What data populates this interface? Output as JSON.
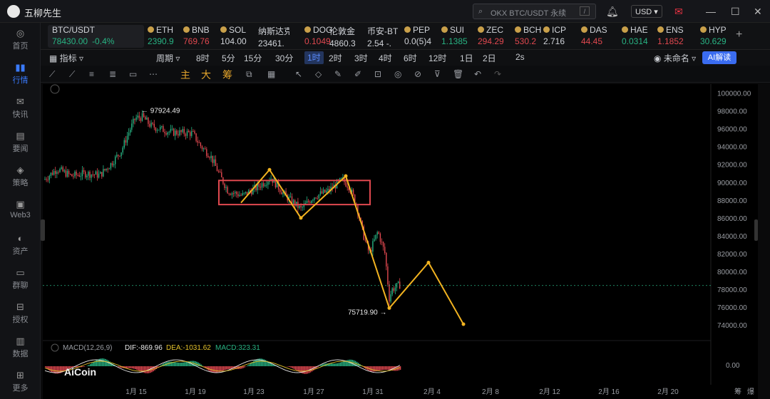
{
  "app": {
    "title": "五柳先生",
    "search_placeholder": "OKX BTC/USDT 永续",
    "search_kbd": "/",
    "currency": "USD"
  },
  "sidebar": [
    {
      "label": "首页",
      "icon": "home-icon"
    },
    {
      "label": "行情",
      "icon": "chart-bars-icon",
      "active": true
    },
    {
      "label": "快讯",
      "icon": "flash-icon"
    },
    {
      "label": "要闻",
      "icon": "news-icon"
    },
    {
      "label": "策略",
      "icon": "robot-icon"
    },
    {
      "label": "Web3",
      "icon": "wallet-icon"
    },
    {
      "label": "资产",
      "icon": "asset-icon"
    },
    {
      "label": "群聊",
      "icon": "chat-icon"
    },
    {
      "label": "授权",
      "icon": "key-icon"
    },
    {
      "label": "数据",
      "icon": "data-icon"
    },
    {
      "label": "更多",
      "icon": "grid-icon"
    }
  ],
  "tickers": [
    {
      "name": "BTC/USDT",
      "price": "78430.00",
      "change": "-0.4%",
      "color": "g"
    },
    {
      "name": "ETH",
      "price": "2390.9",
      "color": "g"
    },
    {
      "name": "BNB",
      "price": "769.76",
      "color": "r"
    },
    {
      "name": "SOL",
      "price": "104.00",
      "color": "w"
    },
    {
      "name": "纳斯达克",
      "price": "23461.",
      "color": "w"
    },
    {
      "name": "DOG",
      "price": "0.1049",
      "color": "r"
    },
    {
      "name": "伦敦金",
      "price": "4860.3",
      "color": "w"
    },
    {
      "name": "币安-BT",
      "price": "2.54 -.",
      "color": "w"
    },
    {
      "name": "PEP",
      "price": "0.0(5)4",
      "color": "w"
    },
    {
      "name": "SUI",
      "price": "1.1385",
      "color": "g"
    },
    {
      "name": "ZEC",
      "price": "294.29",
      "color": "r"
    },
    {
      "name": "BCH",
      "price": "530.2",
      "color": "r"
    },
    {
      "name": "ICP",
      "price": "2.716",
      "color": "w"
    },
    {
      "name": "DAS",
      "price": "44.45",
      "color": "r"
    },
    {
      "name": "HAE",
      "price": "0.0314",
      "color": "g"
    },
    {
      "name": "ENS",
      "price": "1.1852",
      "color": "r"
    },
    {
      "name": "HYP",
      "price": "30.629",
      "color": "g"
    }
  ],
  "toolbar1": {
    "indicators": "指标",
    "period": "周期",
    "intervals": [
      "8时",
      "5分",
      "15分",
      "30分",
      "1时",
      "2时",
      "3时",
      "4时",
      "6时",
      "12时",
      "1日",
      "2日"
    ],
    "active_interval": "1时",
    "refresh": "2s",
    "layout": "未命名",
    "ai": "AI解读"
  },
  "toolbar2": {
    "main": "主",
    "big": "大",
    "chips": "筹"
  },
  "chart_data": {
    "type": "candlestick",
    "symbol": "BTC/USDT",
    "interval": "1H",
    "yticks": [
      "100000.00",
      "98000.00",
      "96000.00",
      "94000.00",
      "92000.00",
      "90000.00",
      "88000.00",
      "86000.00",
      "84000.00",
      "82000.00",
      "80000.00",
      "78000.00",
      "76000.00",
      "74000.00"
    ],
    "ylim": [
      72500,
      101000
    ],
    "xticks": [
      "1月 15",
      "1月 19",
      "1月 23",
      "1月 27",
      "1月 31",
      "2月 4",
      "2月 8",
      "2月 12",
      "2月 16",
      "2月 20",
      "筹",
      "爆"
    ],
    "high_label": "97924.49",
    "high": 97924.49,
    "low_label": "75719.90",
    "low": 75719.9,
    "current_price": 78430.0,
    "range_box": {
      "top": 90200,
      "bottom": 87500
    },
    "projection": [
      [
        78200,
        79700
      ],
      [
        80900,
        79500
      ]
    ],
    "macd": {
      "label": "MACD(12,26,9)",
      "dif": "DIF:-869.96",
      "dea": "DEA:-1031.62",
      "macd": "MACD:323.31",
      "zero": "0.00"
    }
  },
  "watermark": "AiCoin"
}
